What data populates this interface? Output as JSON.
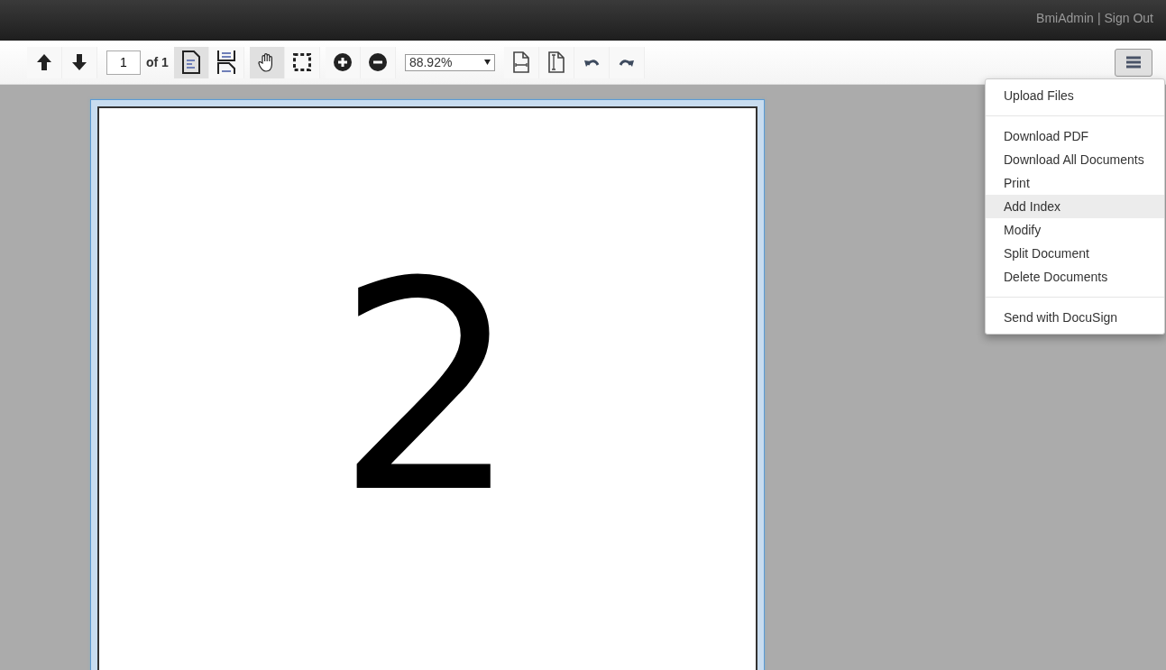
{
  "header": {
    "user": "BmiAdmin",
    "separator": "|",
    "sign_out": "Sign Out"
  },
  "toolbar": {
    "page_input": "1",
    "page_total": "of 1",
    "view_modes": [
      {
        "selected": true
      },
      {
        "selected": false
      }
    ],
    "tools": [
      {
        "selected": true
      },
      {
        "selected": false
      }
    ],
    "zoom": "88.92%"
  },
  "menu": {
    "groups": [
      [
        {
          "label": "Upload Files",
          "selected": false
        }
      ],
      [
        {
          "label": "Download PDF",
          "selected": false
        },
        {
          "label": "Download All Documents",
          "selected": false
        },
        {
          "label": "Print",
          "selected": false
        },
        {
          "label": "Add Index",
          "selected": true
        },
        {
          "label": "Modify",
          "selected": false
        },
        {
          "label": "Split Document",
          "selected": false
        },
        {
          "label": "Delete Documents",
          "selected": false
        }
      ],
      [
        {
          "label": "Send with DocuSign",
          "selected": false
        }
      ]
    ]
  },
  "document": {
    "page_text": "2"
  }
}
